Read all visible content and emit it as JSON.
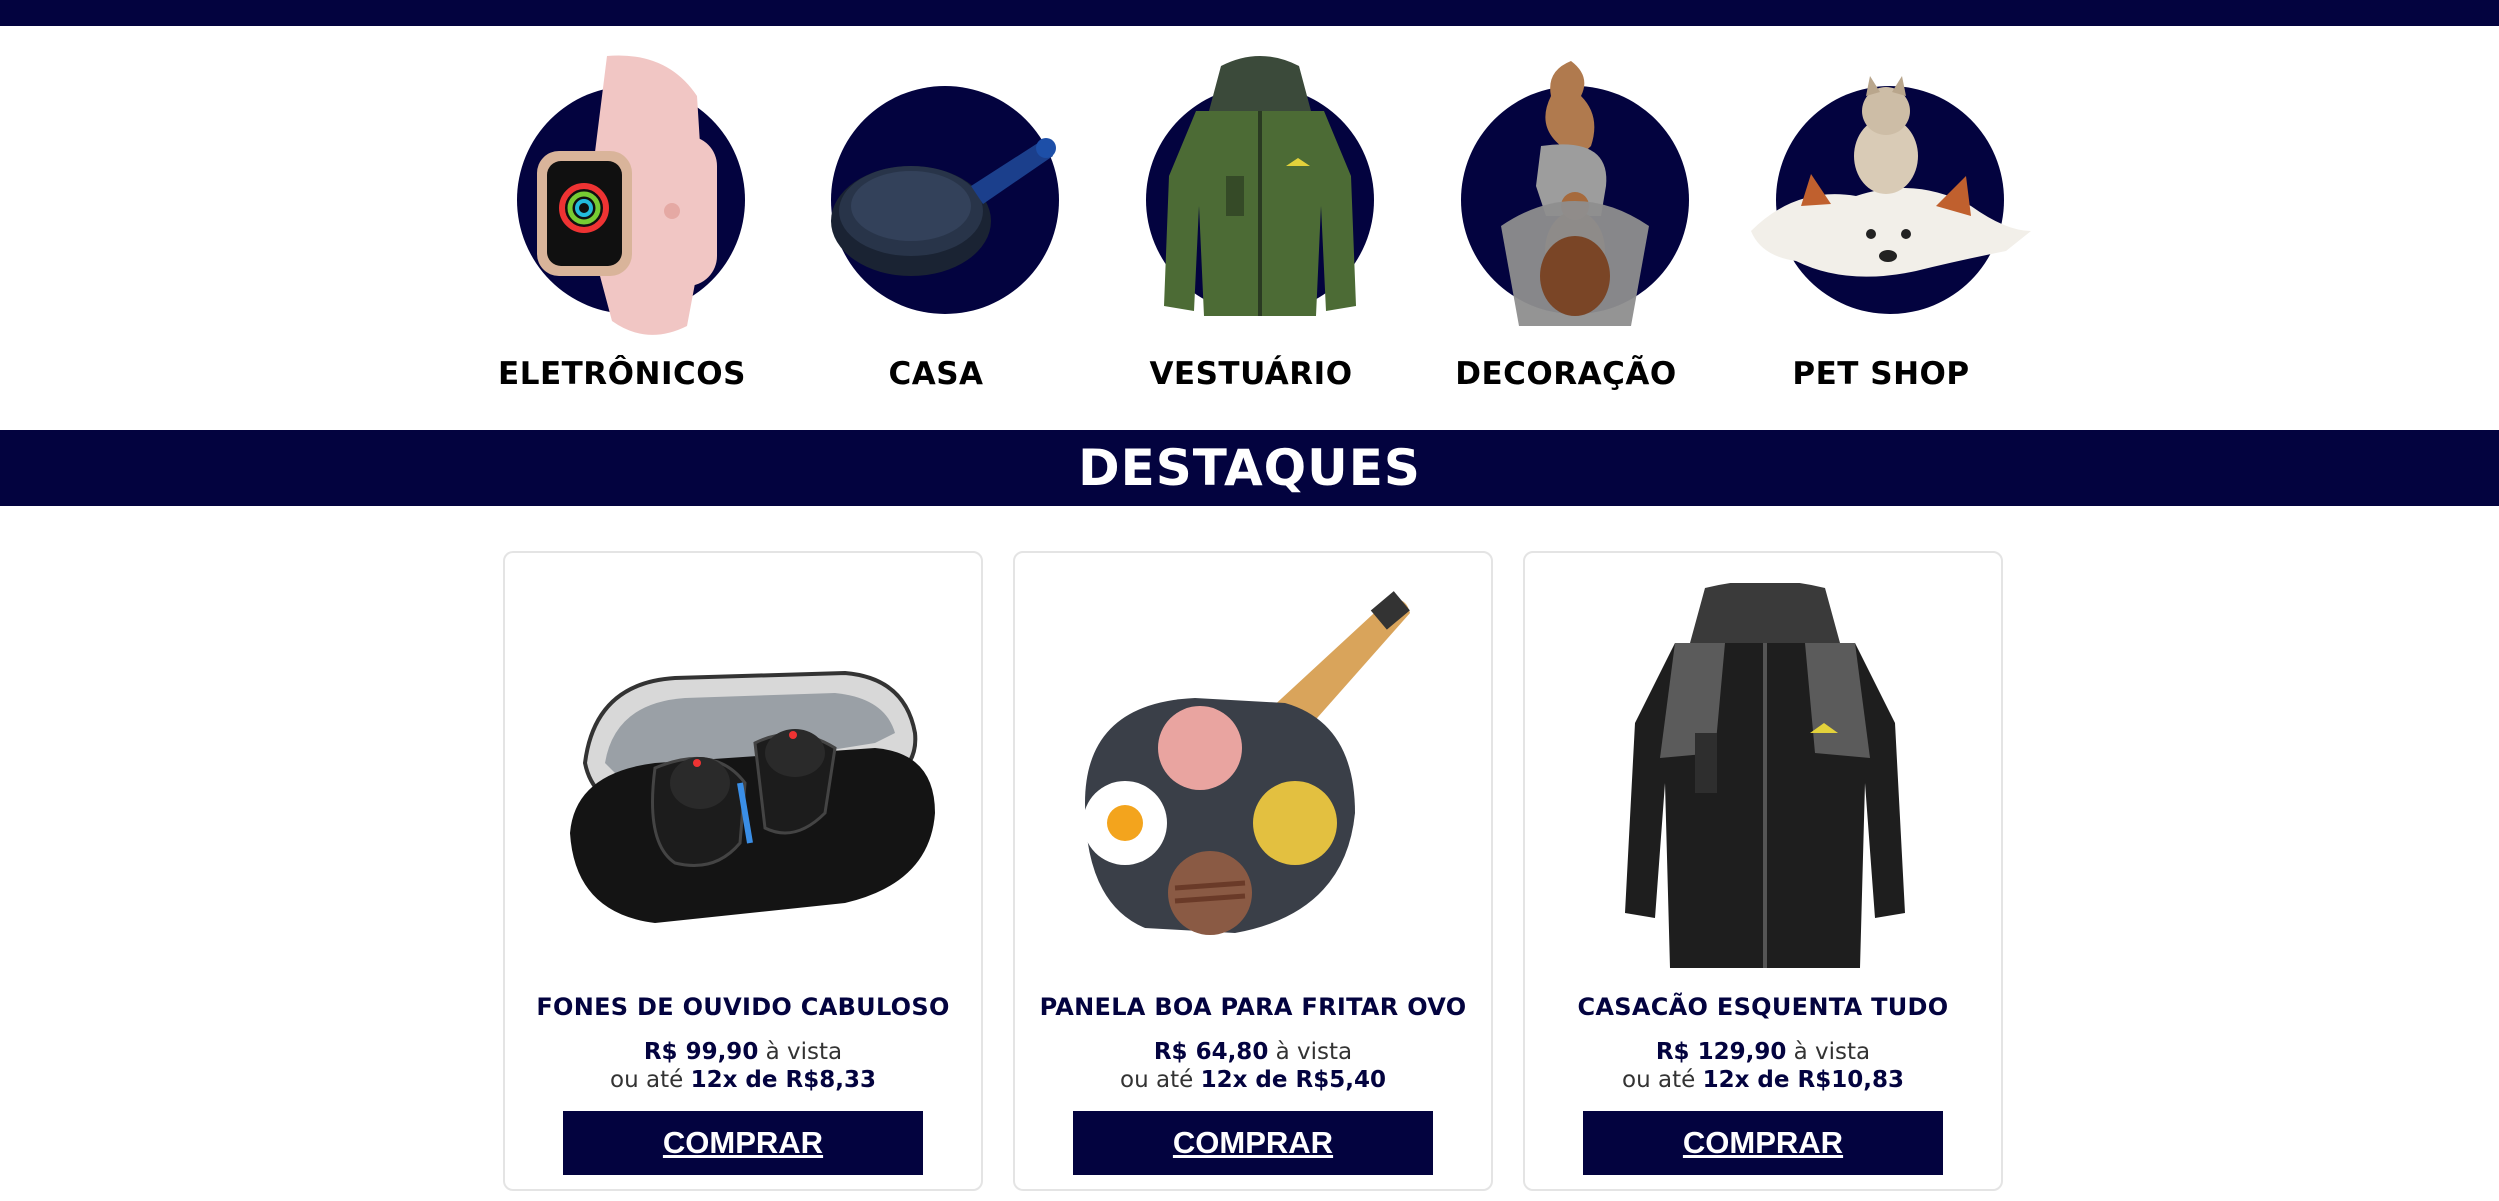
{
  "colors": {
    "brand": "#03033f",
    "background": "#ffffff",
    "card_border": "#e4e4e4"
  },
  "categories": [
    {
      "label": "ELETRÔNICOS",
      "icon": "smartwatch-image"
    },
    {
      "label": "CASA",
      "icon": "frying-pan-image"
    },
    {
      "label": "VESTUÁRIO",
      "icon": "jacket-image"
    },
    {
      "label": "DECORAÇÃO",
      "icon": "decorative-sculpture-image"
    },
    {
      "label": "PET SHOP",
      "icon": "pets-image"
    }
  ],
  "section_title": "DESTAQUES",
  "products": [
    {
      "name": "FONES DE OUVIDO CABULOSO",
      "price": "R$ 99,90",
      "cash_suffix": " à vista",
      "installment_prefix": "ou até ",
      "installment": "12x de R$8,33",
      "button": "COMPRAR",
      "icon": "earbuds-image"
    },
    {
      "name": "PANELA BOA PARA FRITAR OVO",
      "price": "R$ 64,80",
      "cash_suffix": " à vista",
      "installment_prefix": "ou até ",
      "installment": "12x de R$5,40",
      "button": "COMPRAR",
      "icon": "egg-pan-image"
    },
    {
      "name": "CASACÃO ESQUENTA TUDO",
      "price": "R$ 129,90",
      "cash_suffix": " à vista",
      "installment_prefix": "ou até ",
      "installment": "12x de R$10,83",
      "button": "COMPRAR",
      "icon": "black-jacket-image"
    }
  ]
}
